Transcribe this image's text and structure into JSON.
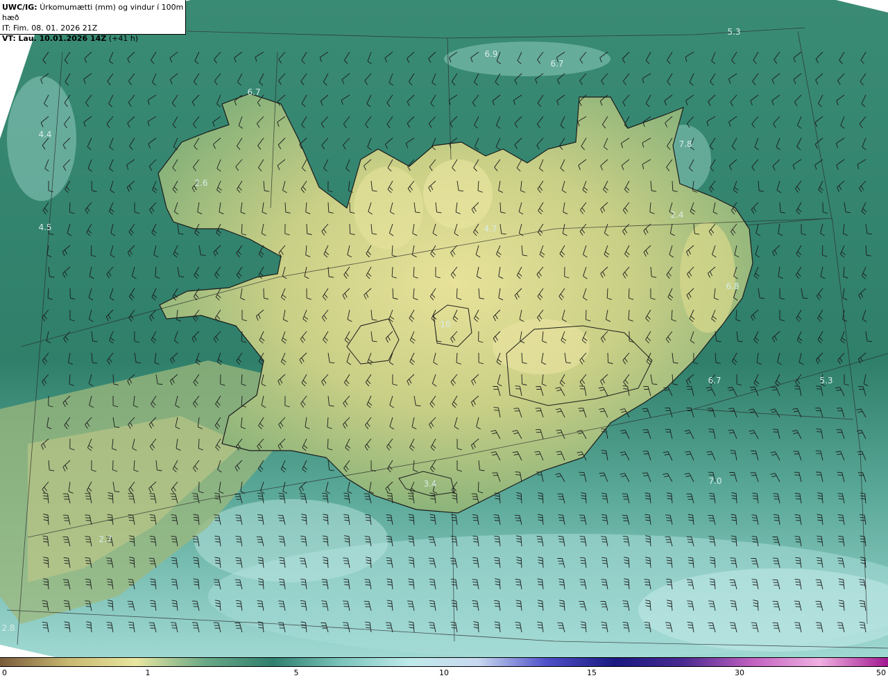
{
  "header": {
    "product": "UWC/IG:",
    "title": "Úrkomumætti (mm) og vindur í 100m hæð",
    "issue_time": "IT: Fim. 08. 01. 2026 21Z",
    "valid_prefix": "VT:",
    "valid_time": "Lau. 10.01.2026 14Z",
    "lead_time": "(+41 h)"
  },
  "map_labels": [
    {
      "text": "5.3"
    },
    {
      "text": "6.9"
    },
    {
      "text": "6.7"
    },
    {
      "text": "6.7"
    },
    {
      "text": "7.8"
    },
    {
      "text": "2.4"
    },
    {
      "text": "4.7"
    },
    {
      "text": "6.8"
    },
    {
      "text": "6.7"
    },
    {
      "text": "5.3"
    },
    {
      "text": "7.0"
    },
    {
      "text": "3.4"
    },
    {
      "text": "2.7"
    },
    {
      "text": "2.8"
    },
    {
      "text": "4.5"
    },
    {
      "text": "10"
    },
    {
      "text": "4.4"
    },
    {
      "text": "2.6"
    }
  ],
  "colorbar": {
    "ticks": [
      "0",
      "1",
      "5",
      "10",
      "15",
      "30",
      "50"
    ],
    "colors": [
      "#7a5c3c",
      "#c8b870",
      "#e8e6a0",
      "#6aa886",
      "#2f7f6e",
      "#7cc4bc",
      "#bfeaea",
      "#c8d8f0",
      "#5050c8",
      "#1a1a80",
      "#4a2a90",
      "#c060c0",
      "#f0b0e0",
      "#a01890"
    ]
  },
  "palette": {
    "ocean_dark": "#1f6b5c",
    "ocean_mid": "#3d8f78",
    "ocean_light": "#8fd0c8",
    "land_low": "#7aa878",
    "land_high": "#e6e08c",
    "coast": "#1a1a1a"
  }
}
